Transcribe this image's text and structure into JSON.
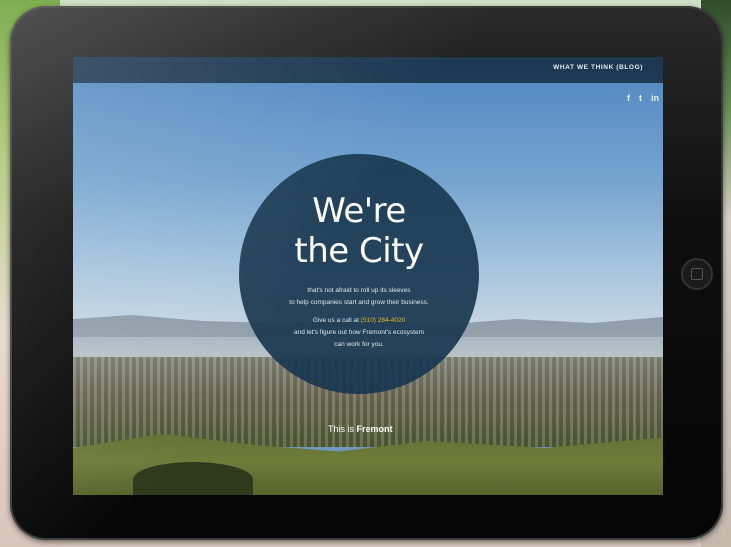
{
  "nav": {
    "blog_link": "WHAT WE THINK (BLOG)"
  },
  "social": {
    "facebook": "f",
    "twitter": "t",
    "linkedin": "in"
  },
  "hero": {
    "headline_line1": "We're",
    "headline_line2": "the City",
    "body_line1": "that's not afraid to roll up its sleeves",
    "body_line2": "to help companies start and grow their business.",
    "cta_prefix": "Give us a call at",
    "phone": "(510) 284-4020",
    "cta_line2": "and let's figure out how Fremont's ecosystem",
    "cta_line3": "can work for you."
  },
  "footer": {
    "prefix": "This is",
    "city": "Fremont"
  },
  "colors": {
    "nav_bg": "#173047",
    "circle_bg": "#193750",
    "accent_phone": "#f0b429"
  }
}
